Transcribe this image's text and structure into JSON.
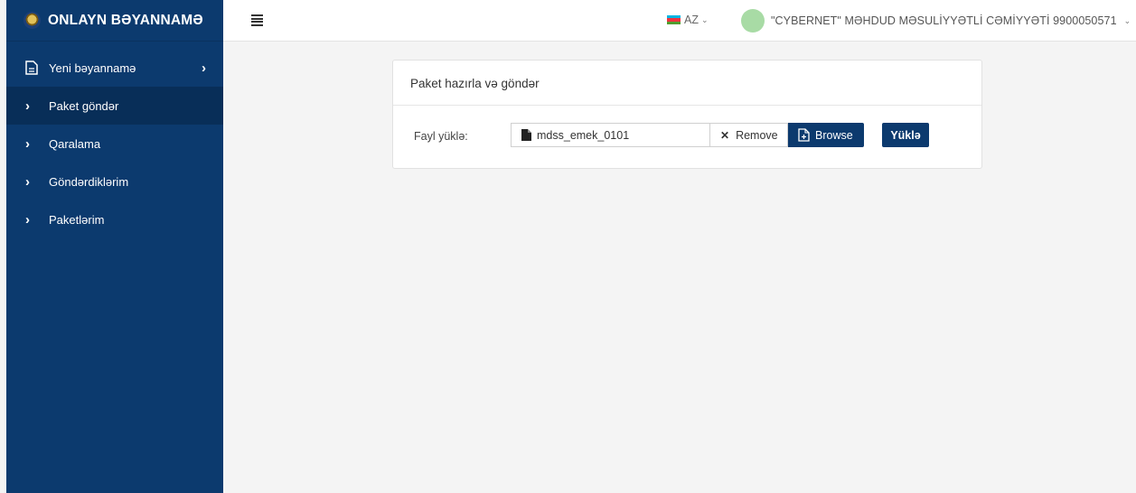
{
  "app": {
    "title": "ONLAYN BƏYANNAMƏ"
  },
  "sidebar": {
    "items": [
      {
        "label": "Yeni bəyannamə",
        "icon": "document-icon",
        "active": false
      },
      {
        "label": "Paket göndər",
        "icon": "chevron-right-icon",
        "active": true
      },
      {
        "label": "Qaralama",
        "icon": "chevron-right-icon",
        "active": false
      },
      {
        "label": "Göndərdiklərim",
        "icon": "chevron-right-icon",
        "active": false
      },
      {
        "label": "Paketlərim",
        "icon": "chevron-right-icon",
        "active": false
      }
    ]
  },
  "header": {
    "language": "AZ",
    "user_name": "\"CYBERNET\" MƏHDUD MƏSULİYYƏTLİ CƏMİYYƏTİ 9900050571"
  },
  "panel": {
    "title": "Paket hazırla və göndər",
    "file_label": "Fayl yüklə:",
    "file_name": "mdss_emek_0101",
    "remove_label": "Remove",
    "browse_label": "Browse",
    "upload_label": "Yüklə"
  },
  "colors": {
    "sidebar_bg": "#0c3a6e",
    "sidebar_active": "#082e58",
    "button_primary": "#0c3a6e",
    "page_bg": "#f4f4f4"
  }
}
